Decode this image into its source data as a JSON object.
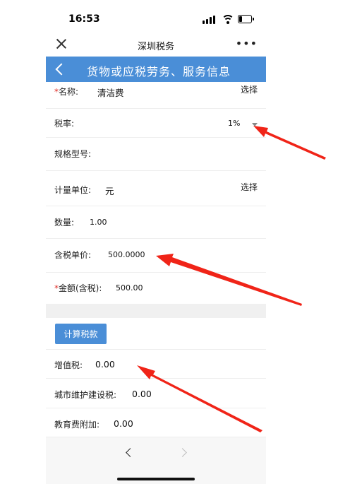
{
  "status_bar": {
    "time": "16:53"
  },
  "header": {
    "title": "深圳税务",
    "more": "•••"
  },
  "page": {
    "title": "货物或应税劳务、服务信息"
  },
  "form": {
    "name": {
      "required_mark": "*",
      "label": "名称:",
      "value": "清洁费",
      "action": "选择"
    },
    "tax_rate": {
      "label": "税率:",
      "value": "1%"
    },
    "spec_model": {
      "label": "规格型号:"
    },
    "unit": {
      "label": "计量单位:",
      "value": "元",
      "action": "选择"
    },
    "quantity": {
      "label": "数量:",
      "value": "1.00"
    },
    "unit_price": {
      "label": "含税单价:",
      "value": "500.0000"
    },
    "amount": {
      "required_mark": "*",
      "label": "金额(含税):",
      "value": "500.00"
    },
    "calc_button": "计算税款",
    "vat": {
      "label": "增值税:",
      "value": "0.00"
    },
    "city_tax": {
      "label": "城市维护建设税:",
      "value": "0.00"
    },
    "edu_surcharge": {
      "label": "教育费附加:",
      "value": "0.00"
    }
  },
  "colors": {
    "accent": "#4a8ed7",
    "required": "#e0302a",
    "arrow": "#f02418"
  },
  "icons": [
    "close-icon",
    "more-icon",
    "back-icon",
    "caret-down-icon",
    "nav-back-icon",
    "nav-forward-icon",
    "signal-icon",
    "wifi-icon",
    "battery-icon"
  ]
}
